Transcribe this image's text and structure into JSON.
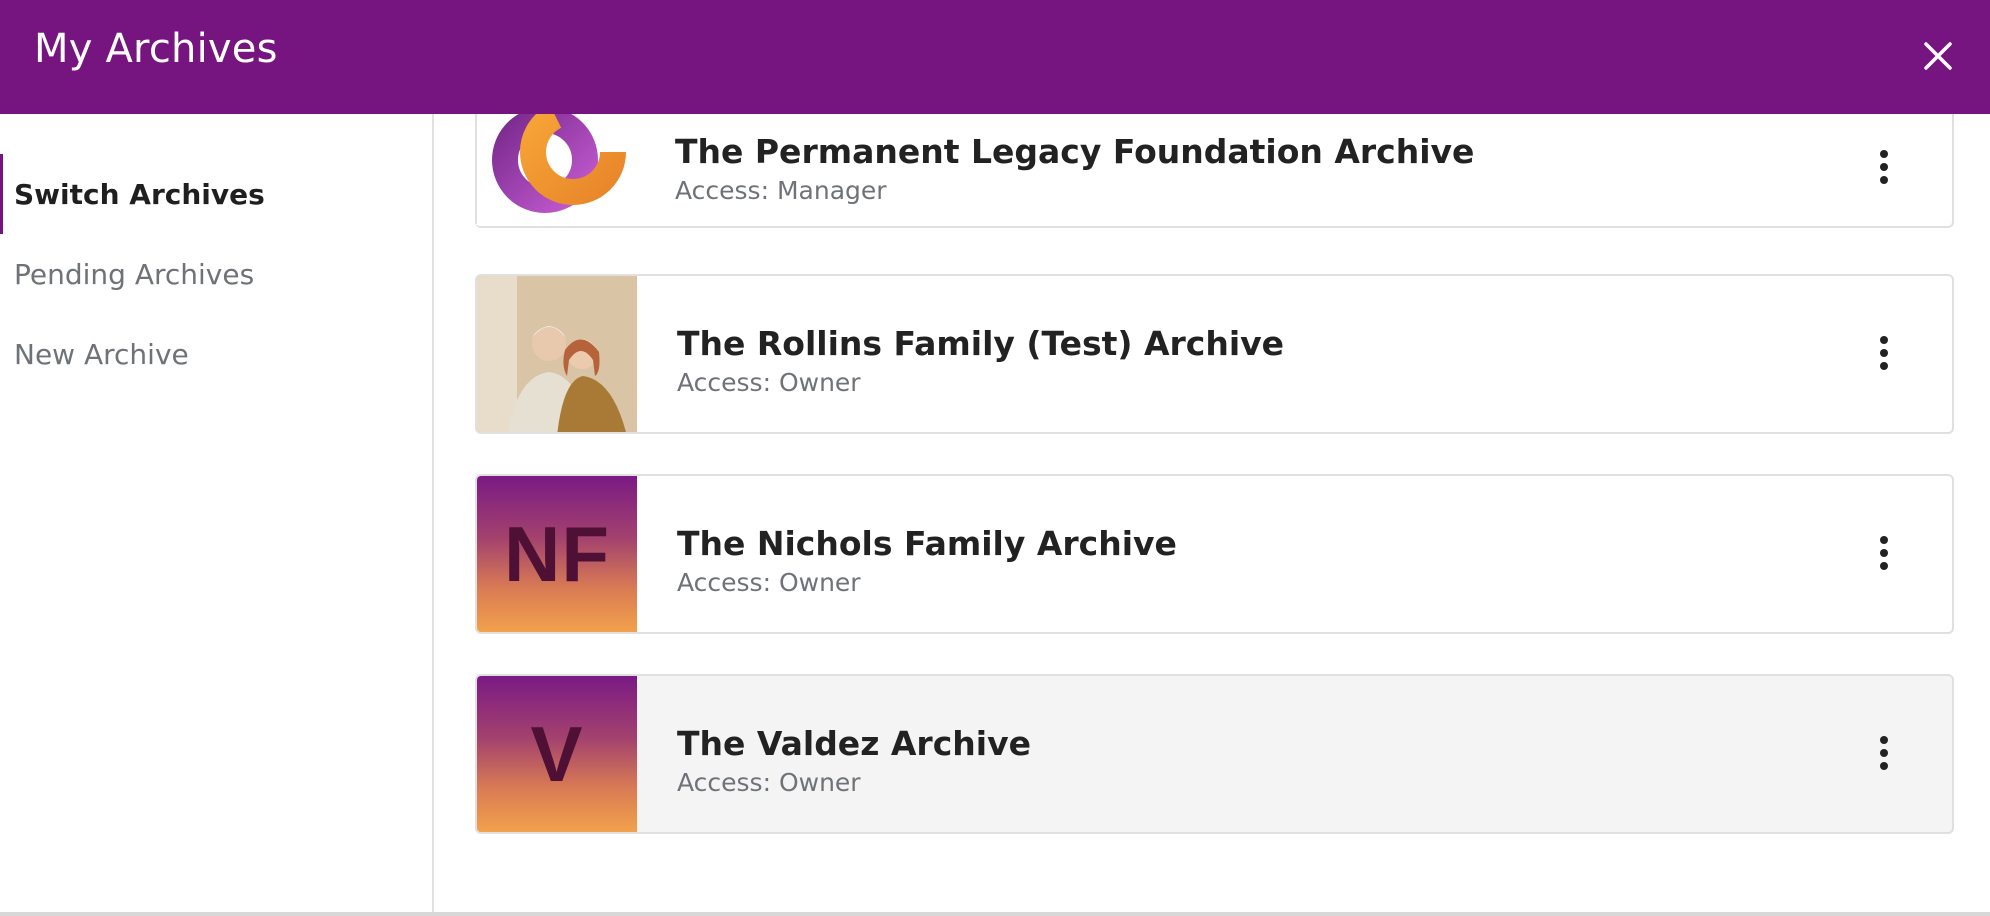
{
  "header": {
    "title": "My Archives",
    "close_icon": "close-icon",
    "background_color": "#76157f"
  },
  "sidebar": {
    "items": [
      {
        "label": "Switch Archives",
        "active": true
      },
      {
        "label": "Pending Archives",
        "active": false
      },
      {
        "label": "New Archive",
        "active": false
      }
    ]
  },
  "archives": [
    {
      "name": "The Permanent Legacy Foundation Archive",
      "access": "Access: Manager",
      "thumbnail": "permanent-logo"
    },
    {
      "name": "The Rollins Family (Test) Archive",
      "access": "Access: Owner",
      "thumbnail": "photo"
    },
    {
      "name": "The Nichols Family Archive",
      "access": "Access: Owner",
      "thumbnail": "initials",
      "initials": "NF"
    },
    {
      "name": "The Valdez Archive",
      "access": "Access: Owner",
      "thumbnail": "initials",
      "initials": "V"
    }
  ],
  "colors": {
    "accent": "#76157f",
    "thumb_gradient_top": "#7a1a85",
    "thumb_gradient_bottom": "#f2a14c"
  }
}
